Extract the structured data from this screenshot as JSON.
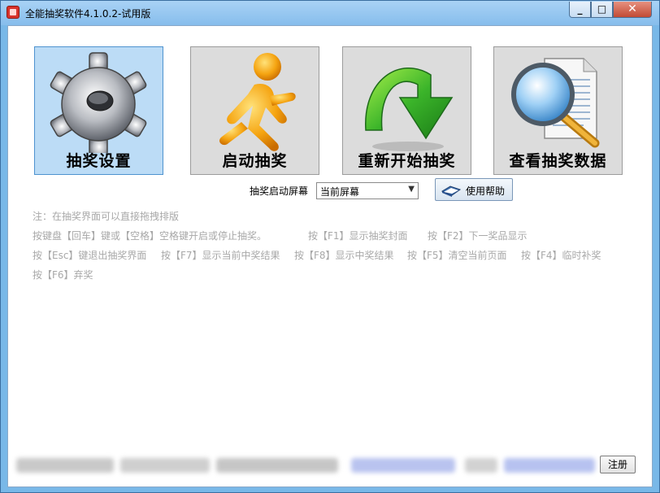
{
  "window": {
    "title": "全能抽奖软件4.1.0.2-试用版",
    "minimize_glyph": "_",
    "maximize_glyph": "□",
    "close_glyph": "✕"
  },
  "tiles": [
    {
      "label": "抽奖设置",
      "icon": "gear-icon",
      "selected": true
    },
    {
      "label": "启动抽奖",
      "icon": "running-man-icon",
      "selected": false
    },
    {
      "label": "重新开始抽奖",
      "icon": "curved-down-arrow-icon",
      "selected": false
    },
    {
      "label": "查看抽奖数据",
      "icon": "magnifier-document-icon",
      "selected": false
    }
  ],
  "launch": {
    "label": "抽奖启动屏幕",
    "selected_screen": "当前屏幕",
    "help_button": "使用帮助"
  },
  "hints": {
    "line1": "注：在抽奖界面可以直接拖拽排版",
    "line2_a": "按键盘【回车】键或【空格】空格键开启或停止抽奖。",
    "line2_b": "按【F1】显示抽奖封面",
    "line2_c": "按【F2】下一奖品显示",
    "line3_a": "按【Esc】键退出抽奖界面",
    "line3_b": "按【F7】显示当前中奖结果",
    "line3_c": "按【F8】显示中奖结果",
    "line3_d": "按【F5】清空当前页面",
    "line3_e": "按【F4】临时补奖",
    "line4_a": "按【F6】弃奖"
  },
  "footer": {
    "register_button": "注册"
  },
  "colors": {
    "title_bar": "#86bdec",
    "selected_tile": "#bcdcf6",
    "tile": "#dcdcdc",
    "hint_text": "#a8a8a8",
    "close_button": "#c24a35"
  }
}
